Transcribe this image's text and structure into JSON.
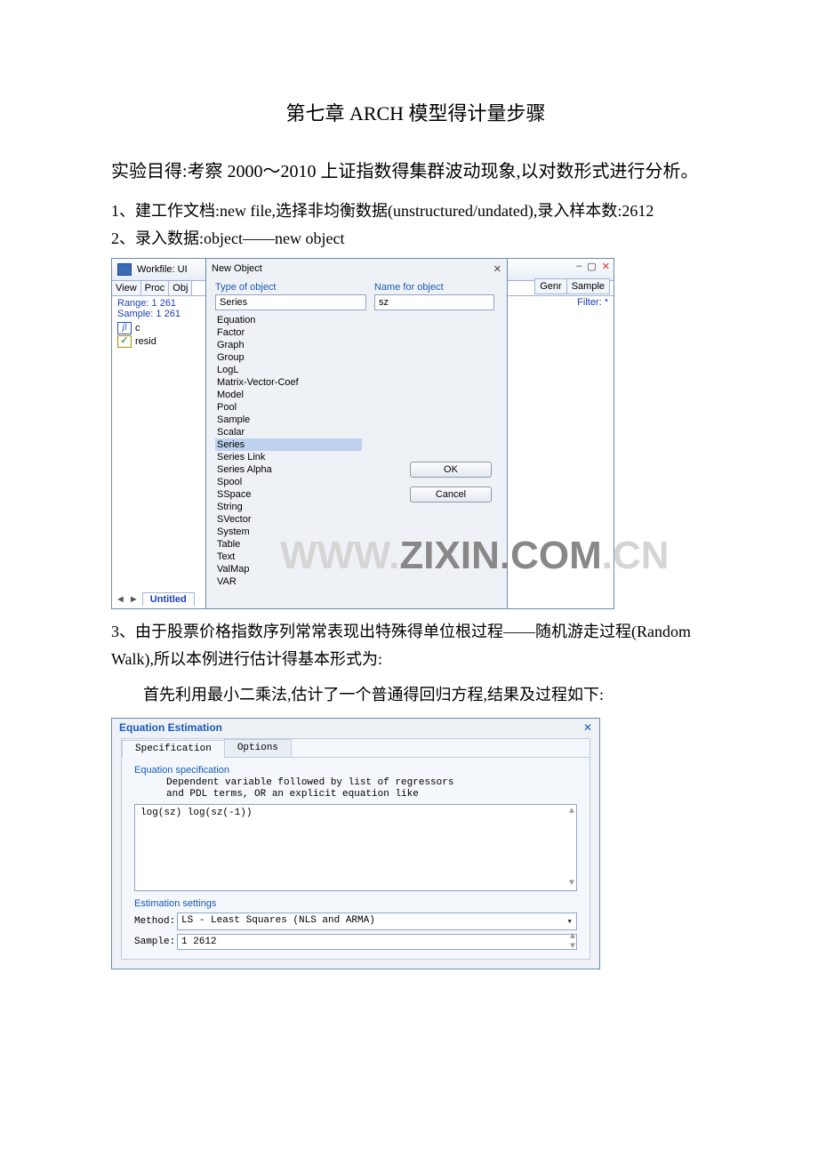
{
  "doc": {
    "title": "第七章  ARCH 模型得计量步骤",
    "intro": "实验目得:考察 2000～2010 上证指数得集群波动现象,以对数形式进行分析。",
    "step1": "1、建工作文档:new file,选择非均衡数据(unstructured/undated),录入样本数:2612",
    "step2": "2、录入数据:object——new object",
    "step3": " 3、由于股票价格指数序列常常表现出特殊得单位根过程——随机游走过程(Random Walk),所以本例进行估计得基本形式为:",
    "note": "首先利用最小二乘法,估计了一个普通得回归方程,结果及过程如下:"
  },
  "wf": {
    "title": "Workfile: UI",
    "btn_view": "View",
    "btn_proc": "Proc",
    "btn_obj": "Obj",
    "range": "Range:  1 261",
    "sample": "Sample: 1 261",
    "obj_c": "c",
    "obj_resid": "resid",
    "tab_untitled": "Untitled",
    "btn_genr": "Genr",
    "btn_sample": "Sample",
    "filter": "Filter: *",
    "min": "–",
    "rest": "▢",
    "close": "✕"
  },
  "newobj": {
    "title": "New Object",
    "close": "✕",
    "type_label": "Type of object",
    "name_label": "Name for object",
    "type_value": "Series",
    "name_value": "sz",
    "ok": "OK",
    "cancel": "Cancel",
    "types": {
      "t1": "Equation",
      "t2": "Factor",
      "t3": "Graph",
      "t4": "Group",
      "t5": "LogL",
      "t6": "Matrix-Vector-Coef",
      "t7": "Model",
      "t8": "Pool",
      "t9": "Sample",
      "t10": "Scalar",
      "sel": "Series",
      "t11": "Series Link",
      "t12": "Series Alpha",
      "t13": "Spool",
      "t14": "SSpace",
      "t15": "String",
      "t16": "SVector",
      "t17": "System",
      "t18": "Table",
      "t19": "Text",
      "t20": "ValMap",
      "t21": "VAR"
    }
  },
  "watermark": {
    "pre": "WWW.",
    "mid": "ZIXIN.COM",
    "suf": ".CN"
  },
  "eq": {
    "title": "Equation Estimation",
    "close": "✕",
    "tab_spec": "Specification",
    "tab_opt": "Options",
    "spec_label": "Equation specification",
    "help1": "Dependent variable followed by list of regressors",
    "help2": "and PDL terms, OR an explicit equation like",
    "formula": "log(sz) log(sz(-1))",
    "est_label": "Estimation settings",
    "method_label": "Method:",
    "method_value": "LS  -  Least Squares (NLS and ARMA)",
    "sample_label": "Sample:",
    "sample_value": "1 2612"
  }
}
